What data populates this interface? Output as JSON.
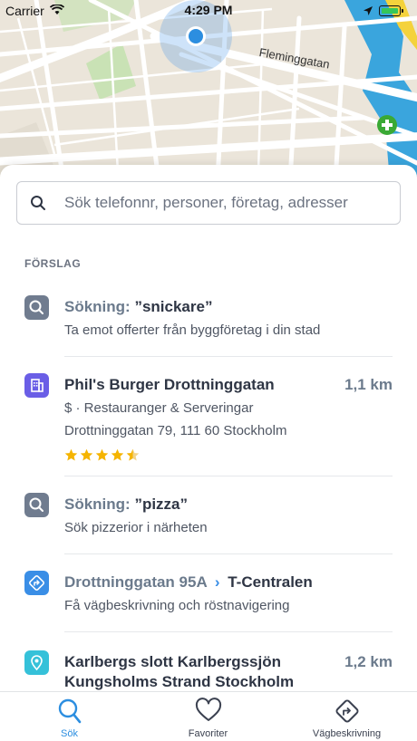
{
  "status_bar": {
    "carrier": "Carrier",
    "time": "4:29 PM"
  },
  "map": {
    "street_label": "Fleminggatan"
  },
  "search": {
    "placeholder": "Sök telefonnr, personer, företag, adresser"
  },
  "suggestions": {
    "section_title": "FÖRSLAG",
    "items": [
      {
        "type": "search",
        "icon": "magnifier-icon",
        "prefix": "Sökning:",
        "title": "”snickare”",
        "subtitle": "Ta emot offerter från byggföretag i din stad"
      },
      {
        "type": "business",
        "icon": "building-icon",
        "title": "Phil's Burger Drottninggatan",
        "distance": "1,1 km",
        "category": "$ · Restauranger & Serveringar",
        "address": "Drottninggatan 79, 111 60 Stockholm",
        "rating": 4.5
      },
      {
        "type": "search",
        "icon": "magnifier-icon",
        "prefix": "Sökning:",
        "title": "”pizza”",
        "subtitle": "Sök pizzerior i närheten"
      },
      {
        "type": "route",
        "icon": "directions-icon",
        "from": "Drottninggatan 95A",
        "to": "T-Centralen",
        "subtitle": "Få vägbeskrivning och röstnavigering"
      },
      {
        "type": "place",
        "icon": "location-pin-icon",
        "title_line1": "Karlbergs slott Karlbergssjön",
        "title_line2": "Kungsholms Strand Stockholm",
        "distance": "1,2 km"
      }
    ]
  },
  "tabs": [
    {
      "label": "Sök",
      "icon": "search-icon",
      "active": true
    },
    {
      "label": "Favoriter",
      "icon": "heart-icon",
      "active": false
    },
    {
      "label": "Vägbeskrivning",
      "icon": "directions-icon",
      "active": false
    }
  ],
  "colors": {
    "accent": "#2c8ee0",
    "search_badge": "#707c8f",
    "business_badge": "#6a5ee6",
    "route_badge": "#3a8ee6",
    "place_badge": "#35c1d9",
    "star": "#f5b400"
  }
}
